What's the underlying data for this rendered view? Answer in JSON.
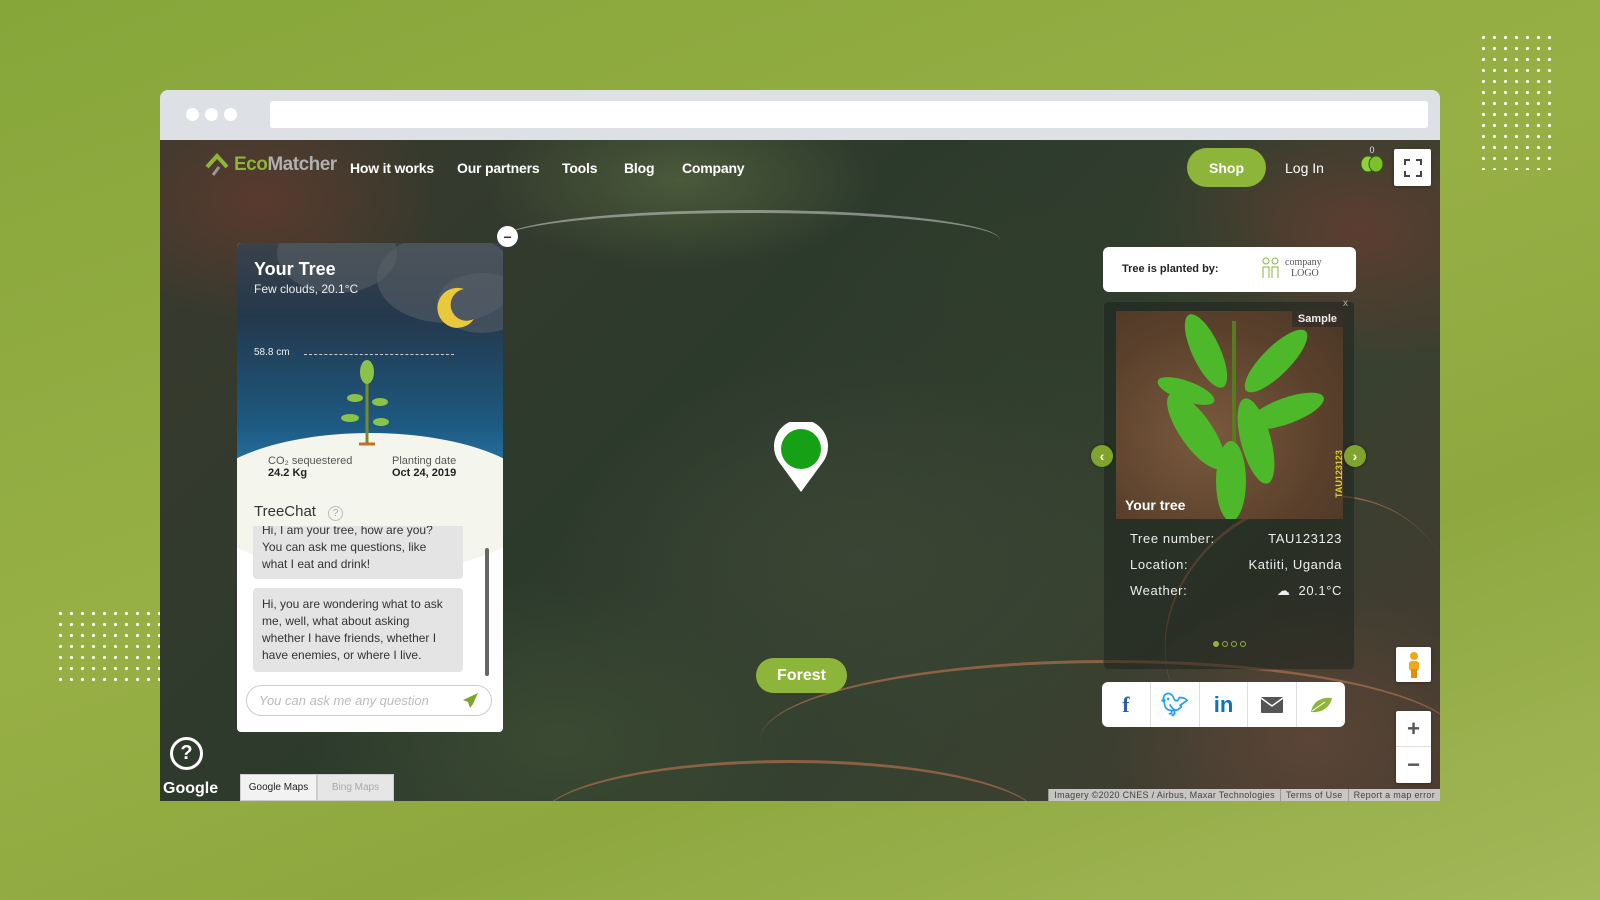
{
  "colors": {
    "accent": "#8db53a",
    "background": "#8fa83f"
  },
  "nav": {
    "logo": "EcoMatcher",
    "items": [
      "How it works",
      "Our partners",
      "Tools",
      "Blog",
      "Company"
    ],
    "shop": "Shop",
    "login": "Log In",
    "leaf_count": "0"
  },
  "tree_card": {
    "title": "Your Tree",
    "weather": "Few clouds, 20.1°C",
    "height": "58.8 cm",
    "co2_label": "CO₂ sequestered",
    "co2_value": "24.2 Kg",
    "date_label": "Planting date",
    "date_value": "Oct 24, 2019",
    "chat_title": "TreeChat",
    "messages": [
      "Hi, I am your tree, how are you? You can ask me questions, like what I eat and drink!",
      "Hi, you are wondering what to ask me, well, what about asking whether I have friends, whether I have enemies, or where I live."
    ],
    "chat_placeholder": "You can ask me any question"
  },
  "planted_by": {
    "label": "Tree is planted by:",
    "logo_line1": "company",
    "logo_line2": "LOGO"
  },
  "tree_info": {
    "sample": "Sample",
    "caption": "Your tree",
    "photo_tag": "TAU123123",
    "close": "x",
    "rows": [
      {
        "label": "Tree number:",
        "value": "TAU123123"
      },
      {
        "label": "Location:",
        "value": "Katiiti, Uganda"
      },
      {
        "label": "Weather:",
        "value": "20.1°C"
      }
    ],
    "active_slide": 1,
    "slide_count": 4
  },
  "share": [
    "facebook",
    "twitter",
    "linkedin",
    "email",
    "ecomatcher-leaf"
  ],
  "forest_button": "Forest",
  "map": {
    "google": "Google",
    "tabs": [
      "Google Maps",
      "Bing Maps"
    ],
    "active_tab": "Google Maps",
    "attribution": [
      "Imagery ©2020 CNES / Airbus, Maxar Technologies",
      "Terms of Use",
      "Report a map error"
    ]
  }
}
